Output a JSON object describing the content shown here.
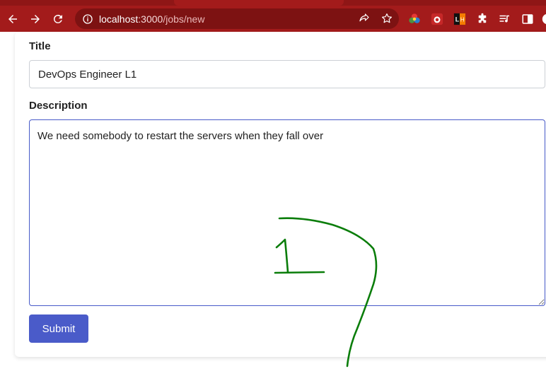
{
  "browser": {
    "url_host": "localhost",
    "url_rest": ":3000",
    "url_path": "/jobs/new"
  },
  "form": {
    "title_label": "Title",
    "title_value": "DevOps Engineer L1",
    "description_label": "Description",
    "description_value": "We need somebody to restart the servers when they fall over",
    "submit_label": "Submit"
  },
  "annotation": {
    "handwritten_number": "1",
    "color": "#0a7d0a"
  },
  "colors": {
    "chrome": "#a31b1b",
    "omnibox": "#7d1212",
    "accent": "#4a5bc9",
    "focus_border": "#4759c8"
  },
  "extensions": [
    "color-picker-icon",
    "red-extension-icon",
    "lighthouse-icon",
    "puzzle-icon",
    "media-icon",
    "sidebar-icon"
  ]
}
